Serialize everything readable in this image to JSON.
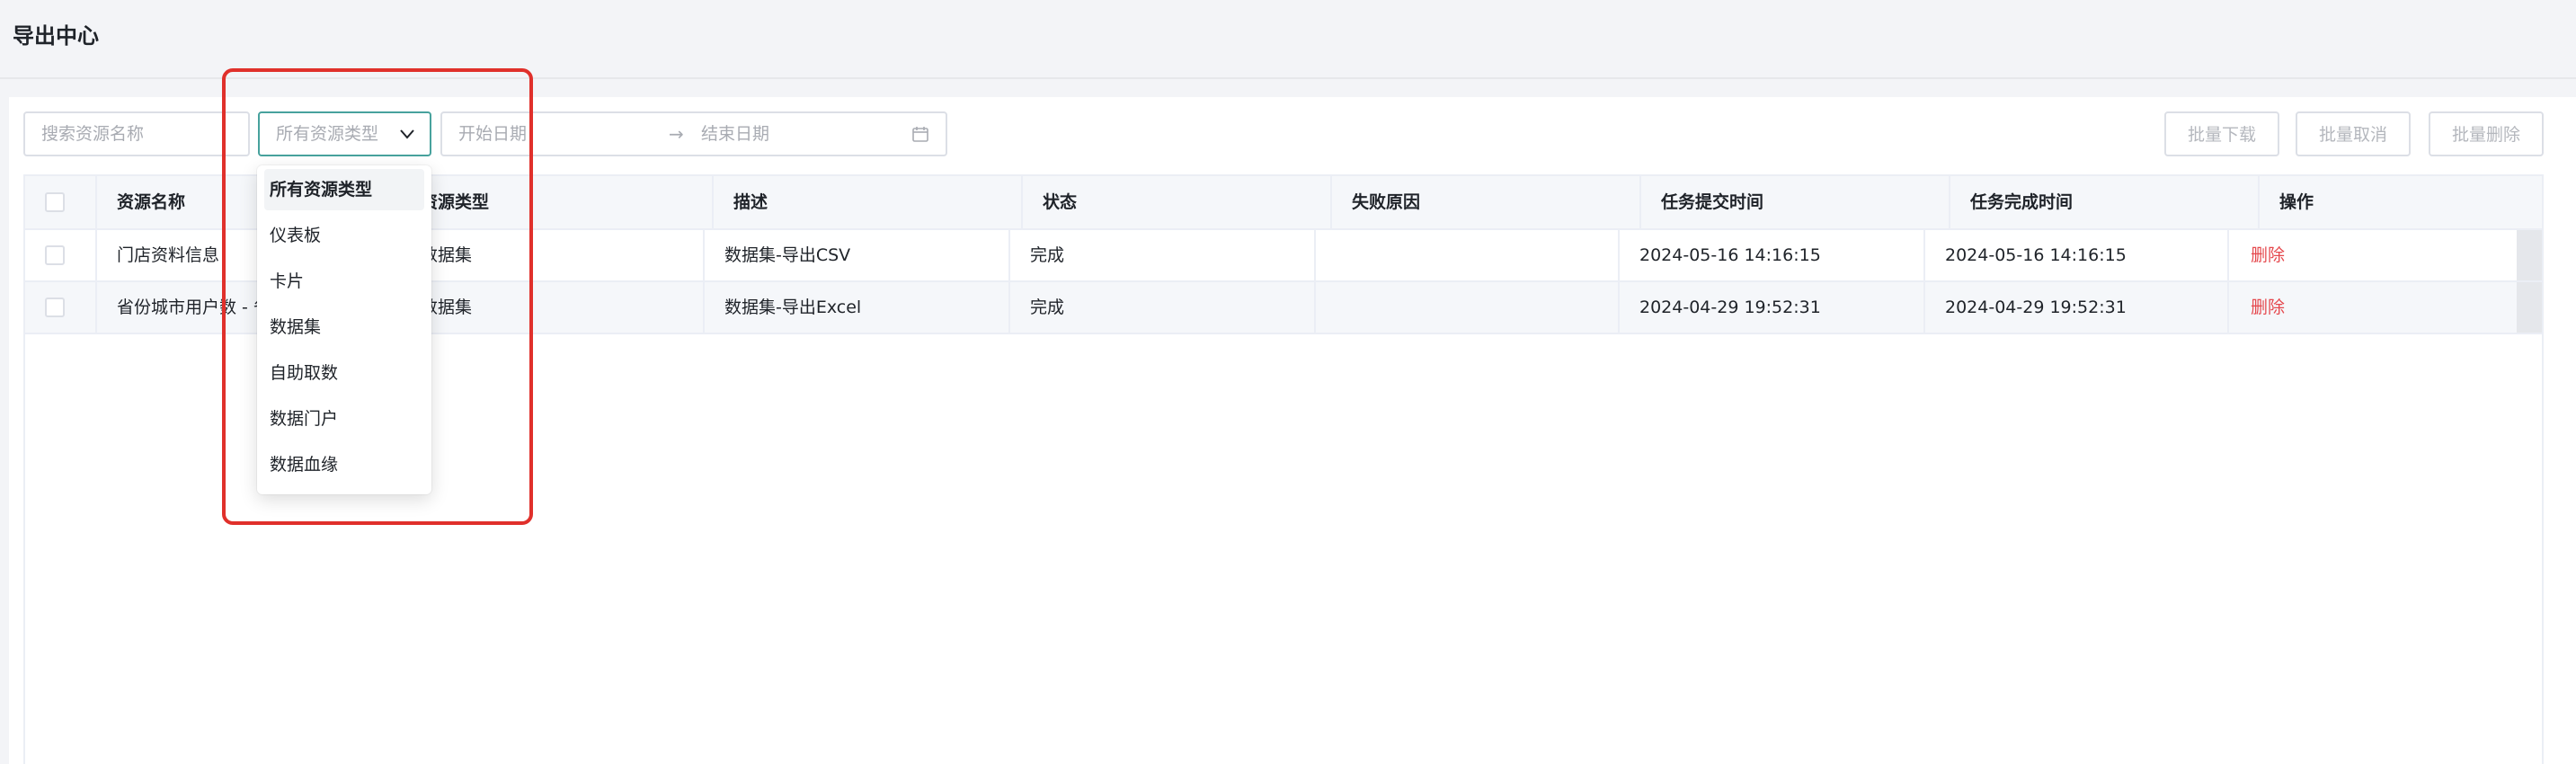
{
  "page": {
    "title": "导出中心"
  },
  "toolbar": {
    "search_placeholder": "搜索资源名称",
    "type_select_value": "所有资源类型",
    "date_start_placeholder": "开始日期",
    "date_separator": "→",
    "date_end_placeholder": "结束日期",
    "batch_download": "批量下载",
    "batch_cancel": "批量取消",
    "batch_delete": "批量删除"
  },
  "table": {
    "headers": [
      "资源名称",
      "资源类型",
      "描述",
      "状态",
      "失败原因",
      "任务提交时间",
      "任务完成时间",
      "操作"
    ],
    "rows": [
      {
        "name": "门店资料信息",
        "type": "数据集",
        "description": "数据集-导出CSV",
        "status": "完成",
        "failure": "",
        "submitted": "2024-05-16 14:16:15",
        "completed": "2024-05-16 14:16:15",
        "action": "删除"
      },
      {
        "name": "省份城市用户数 - 省",
        "type": "数据集",
        "description": "数据集-导出Excel",
        "status": "完成",
        "failure": "",
        "submitted": "2024-04-29 19:52:31",
        "completed": "2024-04-29 19:52:31",
        "action": "删除"
      }
    ]
  },
  "dropdown": {
    "options": [
      "所有资源类型",
      "仪表板",
      "卡片",
      "数据集",
      "自助取数",
      "数据门户",
      "数据血缘"
    ],
    "selected_index": 0
  },
  "colors": {
    "accent": "#47a29d",
    "highlight": "#e0302b",
    "danger": "#e5484d"
  }
}
